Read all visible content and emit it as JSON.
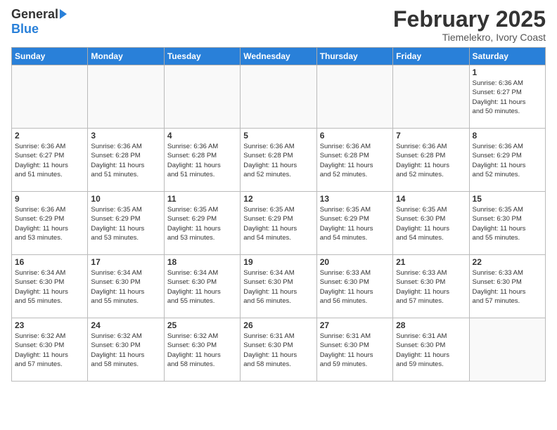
{
  "logo": {
    "general": "General",
    "blue": "Blue"
  },
  "title": "February 2025",
  "location": "Tiemelekro, Ivory Coast",
  "days_of_week": [
    "Sunday",
    "Monday",
    "Tuesday",
    "Wednesday",
    "Thursday",
    "Friday",
    "Saturday"
  ],
  "weeks": [
    [
      {
        "day": "",
        "info": ""
      },
      {
        "day": "",
        "info": ""
      },
      {
        "day": "",
        "info": ""
      },
      {
        "day": "",
        "info": ""
      },
      {
        "day": "",
        "info": ""
      },
      {
        "day": "",
        "info": ""
      },
      {
        "day": "1",
        "info": "Sunrise: 6:36 AM\nSunset: 6:27 PM\nDaylight: 11 hours\nand 50 minutes."
      }
    ],
    [
      {
        "day": "2",
        "info": "Sunrise: 6:36 AM\nSunset: 6:27 PM\nDaylight: 11 hours\nand 51 minutes."
      },
      {
        "day": "3",
        "info": "Sunrise: 6:36 AM\nSunset: 6:28 PM\nDaylight: 11 hours\nand 51 minutes."
      },
      {
        "day": "4",
        "info": "Sunrise: 6:36 AM\nSunset: 6:28 PM\nDaylight: 11 hours\nand 51 minutes."
      },
      {
        "day": "5",
        "info": "Sunrise: 6:36 AM\nSunset: 6:28 PM\nDaylight: 11 hours\nand 52 minutes."
      },
      {
        "day": "6",
        "info": "Sunrise: 6:36 AM\nSunset: 6:28 PM\nDaylight: 11 hours\nand 52 minutes."
      },
      {
        "day": "7",
        "info": "Sunrise: 6:36 AM\nSunset: 6:28 PM\nDaylight: 11 hours\nand 52 minutes."
      },
      {
        "day": "8",
        "info": "Sunrise: 6:36 AM\nSunset: 6:29 PM\nDaylight: 11 hours\nand 52 minutes."
      }
    ],
    [
      {
        "day": "9",
        "info": "Sunrise: 6:36 AM\nSunset: 6:29 PM\nDaylight: 11 hours\nand 53 minutes."
      },
      {
        "day": "10",
        "info": "Sunrise: 6:35 AM\nSunset: 6:29 PM\nDaylight: 11 hours\nand 53 minutes."
      },
      {
        "day": "11",
        "info": "Sunrise: 6:35 AM\nSunset: 6:29 PM\nDaylight: 11 hours\nand 53 minutes."
      },
      {
        "day": "12",
        "info": "Sunrise: 6:35 AM\nSunset: 6:29 PM\nDaylight: 11 hours\nand 54 minutes."
      },
      {
        "day": "13",
        "info": "Sunrise: 6:35 AM\nSunset: 6:29 PM\nDaylight: 11 hours\nand 54 minutes."
      },
      {
        "day": "14",
        "info": "Sunrise: 6:35 AM\nSunset: 6:30 PM\nDaylight: 11 hours\nand 54 minutes."
      },
      {
        "day": "15",
        "info": "Sunrise: 6:35 AM\nSunset: 6:30 PM\nDaylight: 11 hours\nand 55 minutes."
      }
    ],
    [
      {
        "day": "16",
        "info": "Sunrise: 6:34 AM\nSunset: 6:30 PM\nDaylight: 11 hours\nand 55 minutes."
      },
      {
        "day": "17",
        "info": "Sunrise: 6:34 AM\nSunset: 6:30 PM\nDaylight: 11 hours\nand 55 minutes."
      },
      {
        "day": "18",
        "info": "Sunrise: 6:34 AM\nSunset: 6:30 PM\nDaylight: 11 hours\nand 55 minutes."
      },
      {
        "day": "19",
        "info": "Sunrise: 6:34 AM\nSunset: 6:30 PM\nDaylight: 11 hours\nand 56 minutes."
      },
      {
        "day": "20",
        "info": "Sunrise: 6:33 AM\nSunset: 6:30 PM\nDaylight: 11 hours\nand 56 minutes."
      },
      {
        "day": "21",
        "info": "Sunrise: 6:33 AM\nSunset: 6:30 PM\nDaylight: 11 hours\nand 57 minutes."
      },
      {
        "day": "22",
        "info": "Sunrise: 6:33 AM\nSunset: 6:30 PM\nDaylight: 11 hours\nand 57 minutes."
      }
    ],
    [
      {
        "day": "23",
        "info": "Sunrise: 6:32 AM\nSunset: 6:30 PM\nDaylight: 11 hours\nand 57 minutes."
      },
      {
        "day": "24",
        "info": "Sunrise: 6:32 AM\nSunset: 6:30 PM\nDaylight: 11 hours\nand 58 minutes."
      },
      {
        "day": "25",
        "info": "Sunrise: 6:32 AM\nSunset: 6:30 PM\nDaylight: 11 hours\nand 58 minutes."
      },
      {
        "day": "26",
        "info": "Sunrise: 6:31 AM\nSunset: 6:30 PM\nDaylight: 11 hours\nand 58 minutes."
      },
      {
        "day": "27",
        "info": "Sunrise: 6:31 AM\nSunset: 6:30 PM\nDaylight: 11 hours\nand 59 minutes."
      },
      {
        "day": "28",
        "info": "Sunrise: 6:31 AM\nSunset: 6:30 PM\nDaylight: 11 hours\nand 59 minutes."
      },
      {
        "day": "",
        "info": ""
      }
    ]
  ]
}
